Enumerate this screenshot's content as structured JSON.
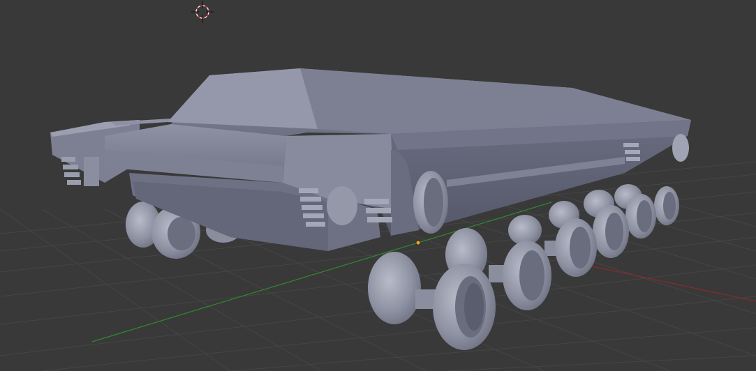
{
  "viewport": {
    "background_color": "#393939",
    "grid_color": "#444444",
    "x_axis_color": "#8a2a2a",
    "y_axis_color": "#2f8a2f",
    "mesh_base_color": "#7b7e90",
    "mesh_shade_color": "#5d6072",
    "mesh_highlight_color": "#a8abb8",
    "origin_color": "#f0a51e",
    "cursor_icon": "3d-cursor-icon",
    "object": "tracked-vehicle-mesh"
  }
}
